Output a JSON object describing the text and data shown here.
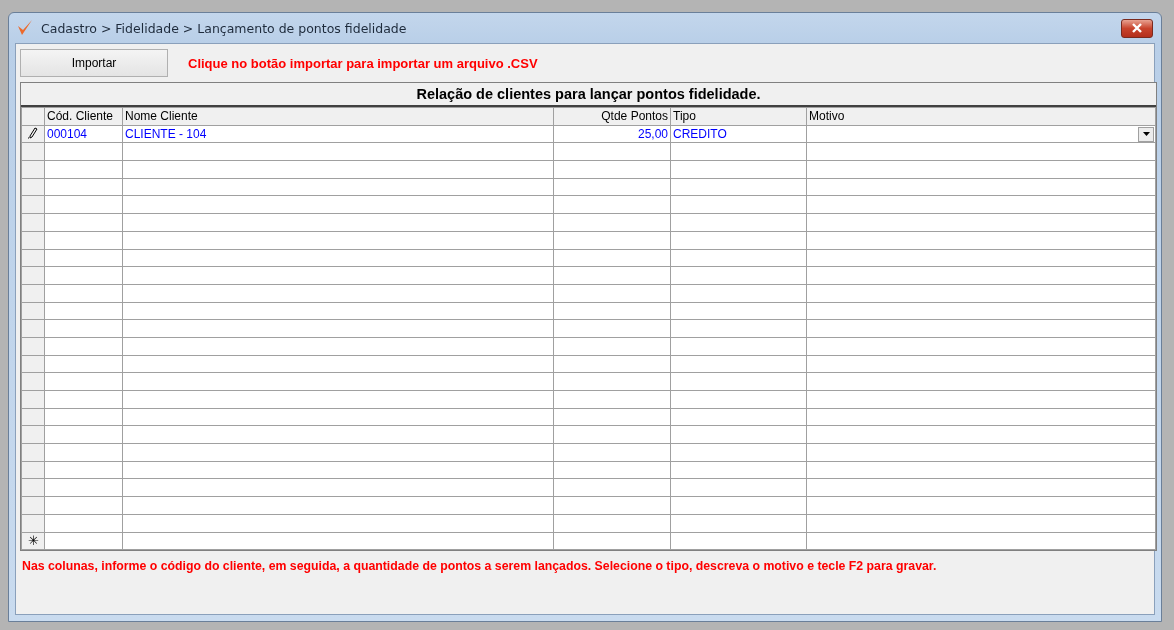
{
  "window": {
    "title": "Cadastro > Fidelidade > Lançamento de pontos fidelidade"
  },
  "toolbar": {
    "import_button": "Importar",
    "hint": "Clique no botão importar para importar um arquivo .CSV"
  },
  "grid": {
    "caption": "Relação de clientes para lançar pontos fidelidade.",
    "columns": [
      {
        "label": "Cód. Cliente",
        "kind": "text"
      },
      {
        "label": "Nome Cliente",
        "kind": "text"
      },
      {
        "label": "Qtde Pontos",
        "kind": "number"
      },
      {
        "label": "Tipo",
        "kind": "text"
      },
      {
        "label": "Motivo",
        "kind": "text"
      }
    ],
    "rows": [
      {
        "editing": true,
        "cells": [
          "000104",
          "CLIENTE - 104",
          "25,00",
          "CREDITO",
          null
        ]
      }
    ],
    "new_row": {
      "marker": "✳"
    }
  },
  "footer": "Nas colunas, informe o código do cliente, em seguida, a quantidade de pontos a serem lançados. Selecione o tipo, descreva o motivo e tecle F2 para gravar."
}
